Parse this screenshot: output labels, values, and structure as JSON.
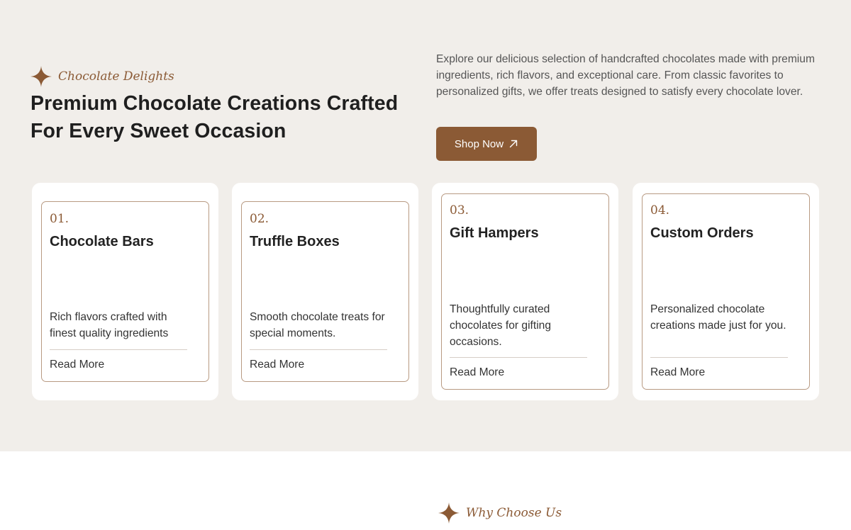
{
  "intro_section": {
    "eyebrow": "Chocolate Delights",
    "heading": "Premium Chocolate Creations Crafted For Every Sweet Occasion",
    "description": "Explore our delicious selection of handcrafted chocolates made with premium ingredients, rich flavors, and exceptional care. From classic favorites to personalized gifts, we offer treats designed to satisfy every chocolate lover.",
    "shop_button": {
      "label": "Shop Now",
      "icon": "arrow-up-right-icon"
    },
    "star_icon": "four-point-star-icon"
  },
  "cards": [
    {
      "number": "01.",
      "title": "Chocolate Bars",
      "description": "Rich flavors crafted with finest quality ingredients",
      "link": "Read More"
    },
    {
      "number": "02.",
      "title": "Truffle Boxes",
      "description": "Smooth chocolate treats for special moments.",
      "link": "Read More"
    },
    {
      "number": "03.",
      "title": "Gift Hampers",
      "description": "Thoughtfully curated chocolates for gifting occasions.",
      "link": "Read More"
    },
    {
      "number": "04.",
      "title": "Custom Orders",
      "description": "Personalized chocolate creations made just for you.",
      "link": "Read More"
    }
  ],
  "why_section": {
    "eyebrow": "Why Choose Us"
  },
  "colors": {
    "accent_brown": "#8b5a35",
    "section_background": "#f1eeea",
    "card_background": "#ffffff",
    "card_border": "#b89a82",
    "heading_text": "#1f1f1f",
    "body_text": "#555555"
  }
}
